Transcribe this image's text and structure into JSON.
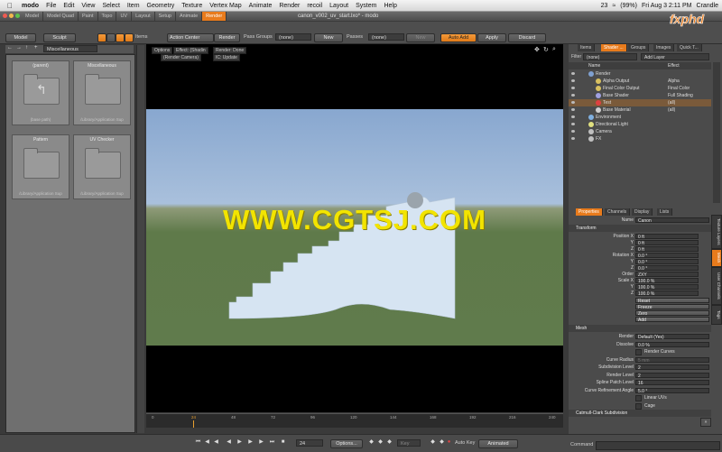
{
  "menubar": {
    "apple": "",
    "app_name": "modo",
    "items": [
      "File",
      "Edit",
      "View",
      "Select",
      "Item",
      "Geometry",
      "Texture",
      "Vertex Map",
      "Animate",
      "Render",
      "recoil",
      "Layout",
      "System",
      "Help"
    ],
    "status": {
      "badge": "23",
      "battery": "(99%)",
      "datetime": "Fri Aug 3  2:11 PM",
      "user": "Crandle"
    }
  },
  "titlebar": {
    "tabs": [
      "Model",
      "Model Quad",
      "Paint",
      "Topo",
      "UV",
      "Layout",
      "Setup",
      "Animate",
      "Render"
    ],
    "active_tab": "Render",
    "document": "canon_v002_uv_start.lxo* - modo"
  },
  "toolbar": {
    "model": "Model",
    "sculpt": "Sculpt",
    "items": "Items",
    "action_center": "Action Center",
    "render": "Render",
    "pass_groups_label": "Pass Groups",
    "pass_groups_value": "(none)",
    "new": "New",
    "passes_label": "Passes",
    "passes_value": "(none)",
    "new2": "New",
    "auto_add": "Auto Add",
    "apply": "Apply",
    "discard": "Discard",
    "miscellaneous": "Miscellaneous"
  },
  "browser": {
    "tiles": [
      {
        "title": "(parent)",
        "sub": "(base path)"
      },
      {
        "title": "Miscellaneous",
        "sub": "/Library/Application Sup"
      },
      {
        "title": "Pattern",
        "sub": "/Library/Application Sup"
      },
      {
        "title": "UV Checker",
        "sub": "/Library/Application Sup"
      }
    ]
  },
  "viewport": {
    "buttons": [
      "Options",
      "Effect: (Shadin",
      "Render: Done",
      "(Render Camera)",
      "IC: Update"
    ],
    "watermark": "WWW.CGTSJ.COM"
  },
  "timeline": {
    "ticks": [
      "0",
      "24",
      "48",
      "72",
      "96",
      "120",
      "144",
      "168",
      "192",
      "216",
      "240"
    ]
  },
  "bottombar": {
    "frame": "24",
    "options": "Options...",
    "key": "Key",
    "auto_key": "Auto Key",
    "animated": "Animated"
  },
  "shader_tree": {
    "tabs": [
      "Items",
      "Shader ...",
      "Groups",
      "Images",
      "Quick T..."
    ],
    "active_tab": "Shader ...",
    "filter_label": "Filter",
    "filter_value": "(none)",
    "add_layer": "Add Layer",
    "col_name": "Name",
    "col_effect": "Effect",
    "rows": [
      {
        "name": "Render",
        "effect": "",
        "indent": 0,
        "color": "#7fa0d0"
      },
      {
        "name": "Alpha Output",
        "effect": "Alpha",
        "indent": 1,
        "color": "#d8c060"
      },
      {
        "name": "Final Color Output",
        "effect": "Final Color",
        "indent": 1,
        "color": "#d8c060"
      },
      {
        "name": "Base Shader",
        "effect": "Full Shading",
        "indent": 1,
        "color": "#a0a0e0"
      },
      {
        "name": "Test",
        "effect": "(all)",
        "indent": 1,
        "color": "#e04040",
        "selected": true
      },
      {
        "name": "Base Material",
        "effect": "(all)",
        "indent": 1,
        "color": "#d0d0d0"
      },
      {
        "name": "Environment",
        "effect": "",
        "indent": 0,
        "color": "#80b0e0"
      },
      {
        "name": "Directional Light",
        "effect": "",
        "indent": 0,
        "color": "#e0e080"
      },
      {
        "name": "Camera",
        "effect": "",
        "indent": 0,
        "color": "#c0c0c0"
      },
      {
        "name": "FX",
        "effect": "",
        "indent": 0,
        "color": "#c0c0c0"
      }
    ]
  },
  "properties": {
    "tabs": [
      "Properties",
      "Channels",
      "Display",
      "Lists"
    ],
    "active_tab": "Properties",
    "name_label": "Name",
    "name_value": "Canon",
    "transform_header": "Transform",
    "rows": [
      {
        "label": "Position X",
        "value": "0 ft"
      },
      {
        "label": "Y",
        "value": "0 ft"
      },
      {
        "label": "Z",
        "value": "0 ft"
      },
      {
        "label": "Rotation X",
        "value": "0.0 °"
      },
      {
        "label": "Y",
        "value": "0.0 °"
      },
      {
        "label": "Z",
        "value": "0.0 °"
      },
      {
        "label": "Order",
        "value": "ZXY"
      },
      {
        "label": "Scale X",
        "value": "100.0 %"
      },
      {
        "label": "Y",
        "value": "100.0 %"
      },
      {
        "label": "Z",
        "value": "100.0 %"
      }
    ],
    "actions": [
      "Reset",
      "Freeze",
      "Zero",
      "Add"
    ],
    "mesh_header": "Mesh",
    "mesh_rows": [
      {
        "label": "Render",
        "value": "Default (Yes)"
      },
      {
        "label": "Dissolve",
        "value": "0.0 %"
      },
      {
        "label": "",
        "value": "Render Curves"
      },
      {
        "label": "Curve Radius",
        "value": "5 mm"
      },
      {
        "label": "Subdivision Level",
        "value": "2"
      },
      {
        "label": "Render Level",
        "value": "2"
      },
      {
        "label": "Spline Patch Level",
        "value": "16"
      },
      {
        "label": "Curve Refinement Angle",
        "value": "5.0 °"
      },
      {
        "label": "",
        "value": "Linear UVs"
      },
      {
        "label": "",
        "value": "Cage"
      }
    ],
    "catmull_header": "Catmull-Clark Subdivision",
    "command_label": "Command"
  },
  "side_tabs": [
    "Texture Layers",
    "Mesh",
    "User Channels",
    "Tags"
  ],
  "colors": {
    "accent": "#e87b1c",
    "sky_top": "#88a7cf",
    "ground": "#607b4c",
    "shape": "#d6e4f2",
    "watermark": "#f2e400"
  }
}
